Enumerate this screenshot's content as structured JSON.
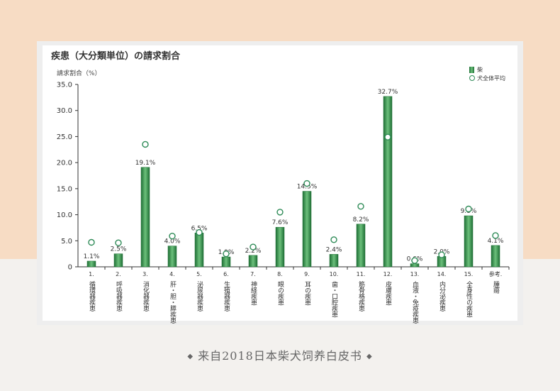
{
  "caption": {
    "text": "来自2018日本柴犬饲养白皮书",
    "left_glyph": "◆",
    "right_glyph": "◆"
  },
  "colors": {
    "bar_dark": "#1e6f35",
    "bar_light": "#6cc07c",
    "marker": "#2e8b57",
    "axis": "#333333",
    "top_background": "#f7dcc4",
    "bottom_background": "#f3f1ee"
  },
  "chart_data": {
    "type": "bar",
    "title": "疾患（大分類単位）の請求割合",
    "ylabel": "請求割合（%）",
    "xlabel": "",
    "ylim": [
      0,
      35
    ],
    "yticks": [
      "0",
      "5.0",
      "10.0",
      "15.0",
      "20.0",
      "25.0",
      "30.0",
      "35.0"
    ],
    "legend": {
      "position": "top-right"
    },
    "categories": [
      "1. 循環器疾患",
      "2. 呼吸器疾患",
      "3. 消化器疾患",
      "4. 肝・胆・膵疾患",
      "5. 泌尿器疾患",
      "6. 生殖器疾患",
      "7. 神経疾患",
      "8. 眼の疾患",
      "9. 耳の疾患",
      "10. 歯・口腔疾患",
      "11. 筋骨格疾患",
      "12. 皮膚疾患",
      "13. 血液・免疫疾患",
      "14. 内分泌疾患",
      "15. 全身性の疾患",
      "参考. 腫瘍"
    ],
    "series": [
      {
        "name": "柴",
        "type": "bar",
        "values": [
          1.1,
          2.5,
          19.1,
          4.0,
          6.5,
          1.9,
          2.2,
          7.6,
          14.5,
          2.4,
          8.2,
          32.7,
          0.6,
          2.0,
          9.8,
          4.1
        ],
        "labels": [
          "1.1%",
          "2.5%",
          "19.1%",
          "4.0%",
          "6.5%",
          "1.9%",
          "2.2%",
          "7.6%",
          "14.5%",
          "2.4%",
          "8.2%",
          "32.7%",
          "0.6%",
          "2.0%",
          "9.8%",
          "4.1%"
        ]
      },
      {
        "name": "犬全体平均",
        "type": "scatter",
        "values": [
          4.7,
          4.6,
          23.5,
          5.9,
          6.6,
          2.5,
          3.8,
          10.5,
          16.0,
          5.2,
          11.6,
          24.9,
          1.2,
          2.3,
          11.1,
          6.0
        ]
      }
    ]
  }
}
